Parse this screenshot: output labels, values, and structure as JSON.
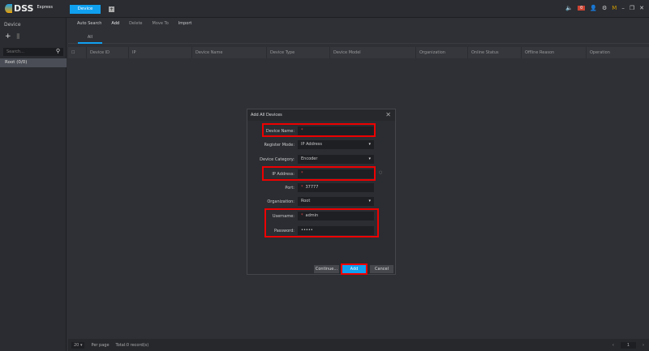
{
  "app": {
    "name": "DSS",
    "sub": "Express",
    "tab": "Device",
    "alarm_count": "0"
  },
  "sidebar": {
    "title": "Device",
    "search_placeholder": "Search...",
    "root": "Root (0/0)"
  },
  "toolbar": [
    "Auto Search",
    "Add",
    "Delete",
    "Move To",
    "Import"
  ],
  "tabs": [
    "All"
  ],
  "columns": [
    "Device ID",
    "IP",
    "Device Name",
    "Device Type",
    "Device Model",
    "Organization",
    "Online Status",
    "Offline Reason",
    "Operation"
  ],
  "footer": {
    "per_page": "20",
    "per_page_label": "Per page",
    "total": "Total:0 record(s)",
    "page": "1"
  },
  "dialog": {
    "title": "Add All Devices",
    "fields": [
      {
        "label": "Device Name:",
        "value": "",
        "required": true
      },
      {
        "label": "Register Mode:",
        "value": "IP Address",
        "dropdown": true
      },
      {
        "label": "Device Category:",
        "value": "Encoder",
        "dropdown": true
      },
      {
        "label": "IP Address:",
        "value": "",
        "required": true
      },
      {
        "label": "Port:",
        "value": "37777",
        "required": true
      },
      {
        "label": "Organization:",
        "value": "Root",
        "dropdown": true
      },
      {
        "label": "Username:",
        "value": "admin",
        "required": true
      },
      {
        "label": "Password:",
        "value": "•••••"
      }
    ],
    "continue": "Continue...",
    "add": "Add",
    "cancel": "Cancel"
  },
  "highlight_color": "#e00000",
  "accent": "#10a0f0"
}
